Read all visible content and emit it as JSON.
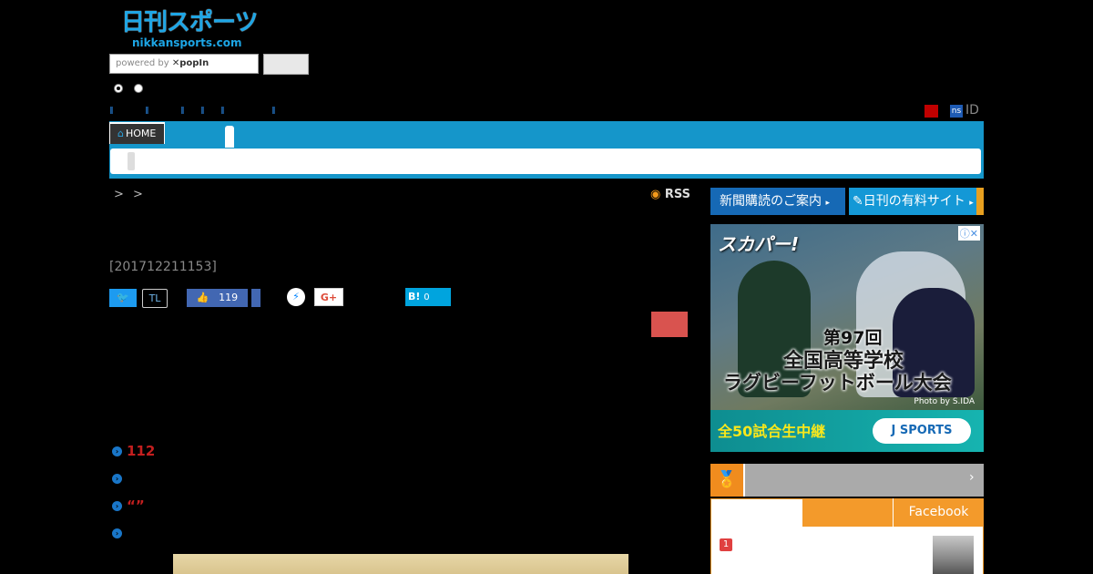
{
  "header": {
    "logo_text": "日刊スポーツ",
    "logo_domain": "nikkansports.com",
    "search_powered_by": "powered by",
    "search_brand": "popIn",
    "search_button": ""
  },
  "top_right": {
    "ns_badge": "ns",
    "id_label": "ID"
  },
  "nav": {
    "home_label": "HOME"
  },
  "article": {
    "breadcrumb": "> >",
    "rss_label": "RSS",
    "timestamp": "[201712211153]",
    "share": {
      "twitter_icon": "twitter-icon",
      "timeline_label": "TL",
      "facebook_like_count": "119",
      "hatena_label": "B!",
      "hatena_count": "0",
      "gplus_label": "G+"
    },
    "related_links": [
      {
        "text": "112"
      },
      {
        "text": ""
      },
      {
        "text": "“”"
      },
      {
        "text": ""
      }
    ]
  },
  "sidebar": {
    "subscribe_label": "新聞購読のご案内",
    "paid_site_label": "日刊の有料サイト",
    "ad": {
      "brand": "スカパー!",
      "edition": "第97回",
      "title_line1": "全国高等学校",
      "title_line2": "ラグビーフットボール大会",
      "credit": "Photo by S.IDA",
      "band_text": "全50試合生中継",
      "button_label": "J SPORTS"
    },
    "ranking": {
      "icon_text": "1",
      "tab_facebook": "Facebook",
      "first_rank": "1"
    }
  },
  "colors": {
    "nav_blue": "#1596ca",
    "accent_orange": "#f39a2b",
    "link_red": "#c41f1f"
  }
}
